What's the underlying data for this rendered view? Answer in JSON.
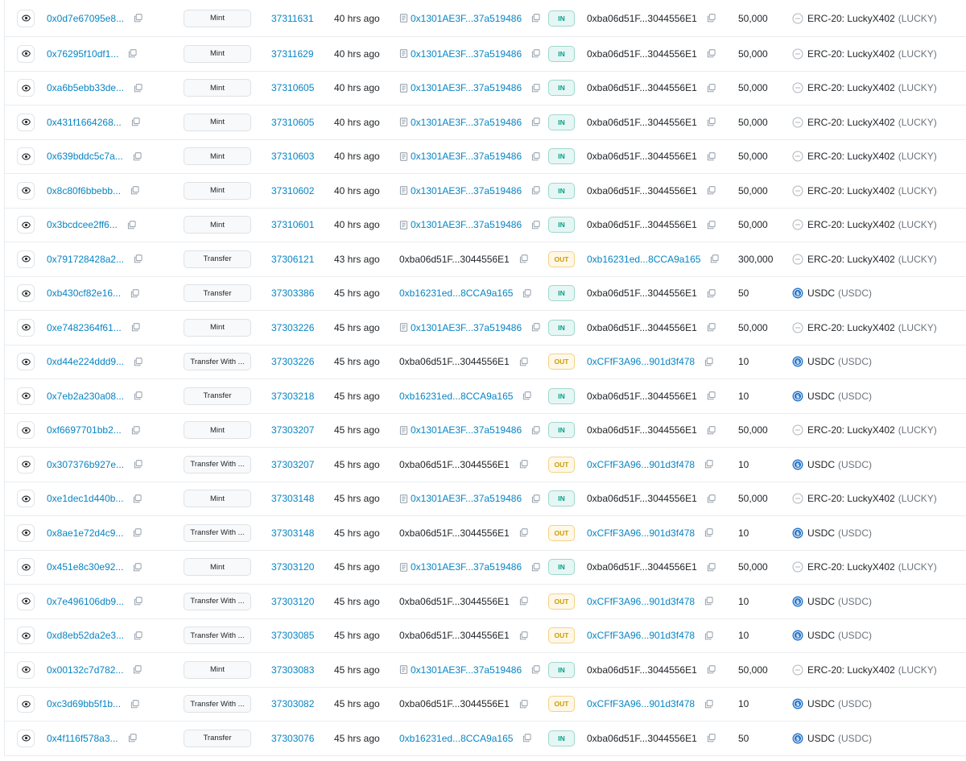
{
  "colors": {
    "link": "#0784c3",
    "in_badge": "#00a186",
    "out_badge": "#cc9a06",
    "usdc": "#2775ca"
  },
  "rows": [
    {
      "hash": "0x0d7e67095e8...",
      "method": "Mint",
      "block": "37311631",
      "age": "40 hrs ago",
      "from": "0x1301AE3F...37a519486",
      "from_contract": true,
      "from_link": true,
      "dir": "IN",
      "to": "0xba06d51F...3044556E1",
      "to_link": false,
      "amount": "50,000",
      "token_type": "erc20",
      "token_name": "ERC-20: LuckyX402",
      "token_symbol": "(LUCKY)"
    },
    {
      "hash": "0x76295f10df1...",
      "method": "Mint",
      "block": "37311629",
      "age": "40 hrs ago",
      "from": "0x1301AE3F...37a519486",
      "from_contract": true,
      "from_link": true,
      "dir": "IN",
      "to": "0xba06d51F...3044556E1",
      "to_link": false,
      "amount": "50,000",
      "token_type": "erc20",
      "token_name": "ERC-20: LuckyX402",
      "token_symbol": "(LUCKY)"
    },
    {
      "hash": "0xa6b5ebb33de...",
      "method": "Mint",
      "block": "37310605",
      "age": "40 hrs ago",
      "from": "0x1301AE3F...37a519486",
      "from_contract": true,
      "from_link": true,
      "dir": "IN",
      "to": "0xba06d51F...3044556E1",
      "to_link": false,
      "amount": "50,000",
      "token_type": "erc20",
      "token_name": "ERC-20: LuckyX402",
      "token_symbol": "(LUCKY)"
    },
    {
      "hash": "0x431f1664268...",
      "method": "Mint",
      "block": "37310605",
      "age": "40 hrs ago",
      "from": "0x1301AE3F...37a519486",
      "from_contract": true,
      "from_link": true,
      "dir": "IN",
      "to": "0xba06d51F...3044556E1",
      "to_link": false,
      "amount": "50,000",
      "token_type": "erc20",
      "token_name": "ERC-20: LuckyX402",
      "token_symbol": "(LUCKY)"
    },
    {
      "hash": "0x639bddc5c7a...",
      "method": "Mint",
      "block": "37310603",
      "age": "40 hrs ago",
      "from": "0x1301AE3F...37a519486",
      "from_contract": true,
      "from_link": true,
      "dir": "IN",
      "to": "0xba06d51F...3044556E1",
      "to_link": false,
      "amount": "50,000",
      "token_type": "erc20",
      "token_name": "ERC-20: LuckyX402",
      "token_symbol": "(LUCKY)"
    },
    {
      "hash": "0x8c80f6bbebb...",
      "method": "Mint",
      "block": "37310602",
      "age": "40 hrs ago",
      "from": "0x1301AE3F...37a519486",
      "from_contract": true,
      "from_link": true,
      "dir": "IN",
      "to": "0xba06d51F...3044556E1",
      "to_link": false,
      "amount": "50,000",
      "token_type": "erc20",
      "token_name": "ERC-20: LuckyX402",
      "token_symbol": "(LUCKY)"
    },
    {
      "hash": "0x3bcdcee2ff6...",
      "method": "Mint",
      "block": "37310601",
      "age": "40 hrs ago",
      "from": "0x1301AE3F...37a519486",
      "from_contract": true,
      "from_link": true,
      "dir": "IN",
      "to": "0xba06d51F...3044556E1",
      "to_link": false,
      "amount": "50,000",
      "token_type": "erc20",
      "token_name": "ERC-20: LuckyX402",
      "token_symbol": "(LUCKY)"
    },
    {
      "hash": "0x791728428a2...",
      "method": "Transfer",
      "block": "37306121",
      "age": "43 hrs ago",
      "from": "0xba06d51F...3044556E1",
      "from_contract": false,
      "from_link": false,
      "dir": "OUT",
      "to": "0xb16231ed...8CCA9a165",
      "to_link": true,
      "amount": "300,000",
      "token_type": "erc20",
      "token_name": "ERC-20: LuckyX402",
      "token_symbol": "(LUCKY)"
    },
    {
      "hash": "0xb430cf82e16...",
      "method": "Transfer",
      "block": "37303386",
      "age": "45 hrs ago",
      "from": "0xb16231ed...8CCA9a165",
      "from_contract": false,
      "from_link": true,
      "dir": "IN",
      "to": "0xba06d51F...3044556E1",
      "to_link": false,
      "amount": "50",
      "token_type": "usdc",
      "token_name": "USDC",
      "token_symbol": "(USDC)"
    },
    {
      "hash": "0xe7482364f61...",
      "method": "Mint",
      "block": "37303226",
      "age": "45 hrs ago",
      "from": "0x1301AE3F...37a519486",
      "from_contract": true,
      "from_link": true,
      "dir": "IN",
      "to": "0xba06d51F...3044556E1",
      "to_link": false,
      "amount": "50,000",
      "token_type": "erc20",
      "token_name": "ERC-20: LuckyX402",
      "token_symbol": "(LUCKY)"
    },
    {
      "hash": "0xd44e224ddd9...",
      "method": "Transfer With ...",
      "block": "37303226",
      "age": "45 hrs ago",
      "from": "0xba06d51F...3044556E1",
      "from_contract": false,
      "from_link": false,
      "dir": "OUT",
      "to": "0xCFfF3A96...901d3f478",
      "to_link": true,
      "amount": "10",
      "token_type": "usdc",
      "token_name": "USDC",
      "token_symbol": "(USDC)"
    },
    {
      "hash": "0x7eb2a230a08...",
      "method": "Transfer",
      "block": "37303218",
      "age": "45 hrs ago",
      "from": "0xb16231ed...8CCA9a165",
      "from_contract": false,
      "from_link": true,
      "dir": "IN",
      "to": "0xba06d51F...3044556E1",
      "to_link": false,
      "amount": "10",
      "token_type": "usdc",
      "token_name": "USDC",
      "token_symbol": "(USDC)"
    },
    {
      "hash": "0xf6697701bb2...",
      "method": "Mint",
      "block": "37303207",
      "age": "45 hrs ago",
      "from": "0x1301AE3F...37a519486",
      "from_contract": true,
      "from_link": true,
      "dir": "IN",
      "to": "0xba06d51F...3044556E1",
      "to_link": false,
      "amount": "50,000",
      "token_type": "erc20",
      "token_name": "ERC-20: LuckyX402",
      "token_symbol": "(LUCKY)"
    },
    {
      "hash": "0x307376b927e...",
      "method": "Transfer With ...",
      "block": "37303207",
      "age": "45 hrs ago",
      "from": "0xba06d51F...3044556E1",
      "from_contract": false,
      "from_link": false,
      "dir": "OUT",
      "to": "0xCFfF3A96...901d3f478",
      "to_link": true,
      "amount": "10",
      "token_type": "usdc",
      "token_name": "USDC",
      "token_symbol": "(USDC)"
    },
    {
      "hash": "0xe1dec1d440b...",
      "method": "Mint",
      "block": "37303148",
      "age": "45 hrs ago",
      "from": "0x1301AE3F...37a519486",
      "from_contract": true,
      "from_link": true,
      "dir": "IN",
      "to": "0xba06d51F...3044556E1",
      "to_link": false,
      "amount": "50,000",
      "token_type": "erc20",
      "token_name": "ERC-20: LuckyX402",
      "token_symbol": "(LUCKY)"
    },
    {
      "hash": "0x8ae1e72d4c9...",
      "method": "Transfer With ...",
      "block": "37303148",
      "age": "45 hrs ago",
      "from": "0xba06d51F...3044556E1",
      "from_contract": false,
      "from_link": false,
      "dir": "OUT",
      "to": "0xCFfF3A96...901d3f478",
      "to_link": true,
      "amount": "10",
      "token_type": "usdc",
      "token_name": "USDC",
      "token_symbol": "(USDC)"
    },
    {
      "hash": "0x451e8c30e92...",
      "method": "Mint",
      "block": "37303120",
      "age": "45 hrs ago",
      "from": "0x1301AE3F...37a519486",
      "from_contract": true,
      "from_link": true,
      "dir": "IN",
      "to": "0xba06d51F...3044556E1",
      "to_link": false,
      "amount": "50,000",
      "token_type": "erc20",
      "token_name": "ERC-20: LuckyX402",
      "token_symbol": "(LUCKY)"
    },
    {
      "hash": "0x7e496106db9...",
      "method": "Transfer With ...",
      "block": "37303120",
      "age": "45 hrs ago",
      "from": "0xba06d51F...3044556E1",
      "from_contract": false,
      "from_link": false,
      "dir": "OUT",
      "to": "0xCFfF3A96...901d3f478",
      "to_link": true,
      "amount": "10",
      "token_type": "usdc",
      "token_name": "USDC",
      "token_symbol": "(USDC)"
    },
    {
      "hash": "0xd8eb52da2e3...",
      "method": "Transfer With ...",
      "block": "37303085",
      "age": "45 hrs ago",
      "from": "0xba06d51F...3044556E1",
      "from_contract": false,
      "from_link": false,
      "dir": "OUT",
      "to": "0xCFfF3A96...901d3f478",
      "to_link": true,
      "amount": "10",
      "token_type": "usdc",
      "token_name": "USDC",
      "token_symbol": "(USDC)"
    },
    {
      "hash": "0x00132c7d782...",
      "method": "Mint",
      "block": "37303083",
      "age": "45 hrs ago",
      "from": "0x1301AE3F...37a519486",
      "from_contract": true,
      "from_link": true,
      "dir": "IN",
      "to": "0xba06d51F...3044556E1",
      "to_link": false,
      "amount": "50,000",
      "token_type": "erc20",
      "token_name": "ERC-20: LuckyX402",
      "token_symbol": "(LUCKY)"
    },
    {
      "hash": "0xc3d69bb5f1b...",
      "method": "Transfer With ...",
      "block": "37303082",
      "age": "45 hrs ago",
      "from": "0xba06d51F...3044556E1",
      "from_contract": false,
      "from_link": false,
      "dir": "OUT",
      "to": "0xCFfF3A96...901d3f478",
      "to_link": true,
      "amount": "10",
      "token_type": "usdc",
      "token_name": "USDC",
      "token_symbol": "(USDC)"
    },
    {
      "hash": "0x4f116f578a3...",
      "method": "Transfer",
      "block": "37303076",
      "age": "45 hrs ago",
      "from": "0xb16231ed...8CCA9a165",
      "from_contract": false,
      "from_link": true,
      "dir": "IN",
      "to": "0xba06d51F...3044556E1",
      "to_link": false,
      "amount": "50",
      "token_type": "usdc",
      "token_name": "USDC",
      "token_symbol": "(USDC)"
    }
  ]
}
